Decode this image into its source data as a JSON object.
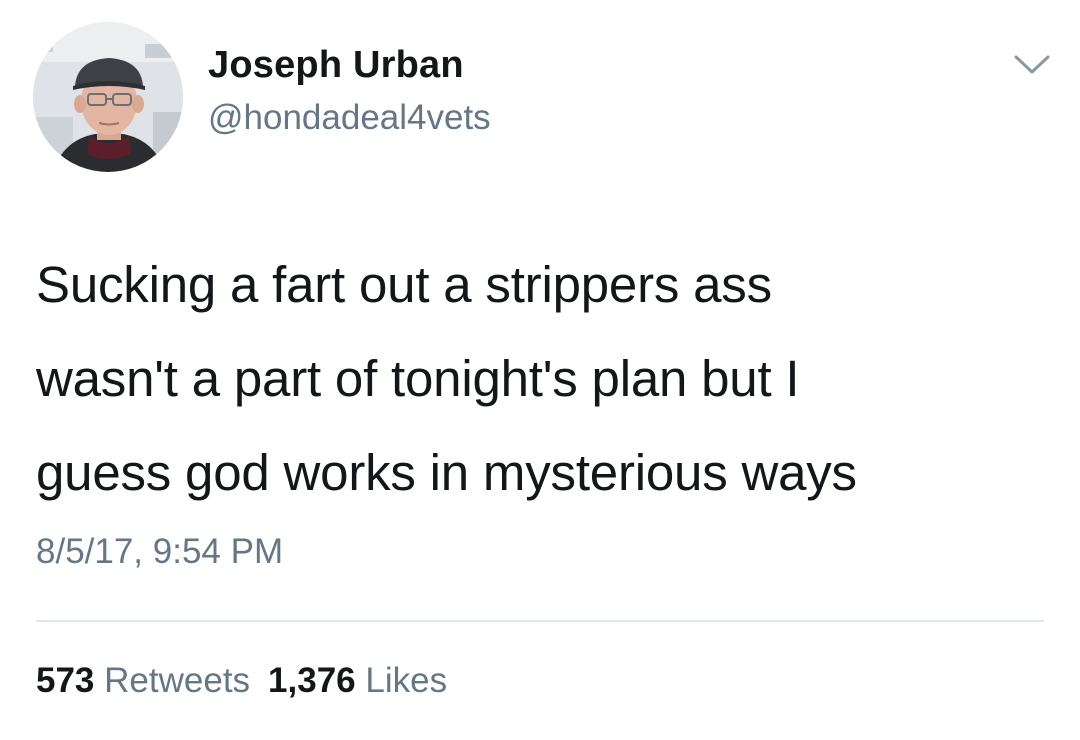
{
  "author": {
    "display_name": "Joseph Urban",
    "handle": "@hondadeal4vets",
    "avatar_icon": "profile-photo"
  },
  "menu": {
    "icon": "chevron-down-icon"
  },
  "tweet": {
    "text_lines": [
      "Sucking a fart out a strippers ass",
      "wasn't a part of tonight's plan but I",
      "guess god works in mysterious ways"
    ],
    "timestamp": "8/5/17, 9:54 PM"
  },
  "stats": {
    "retweets_count": "573",
    "retweets_label": "Retweets",
    "likes_count": "1,376",
    "likes_label": "Likes"
  },
  "colors": {
    "text_primary": "#14171a",
    "text_secondary": "#657786",
    "divider": "#e1e8ed",
    "background": "#ffffff"
  }
}
